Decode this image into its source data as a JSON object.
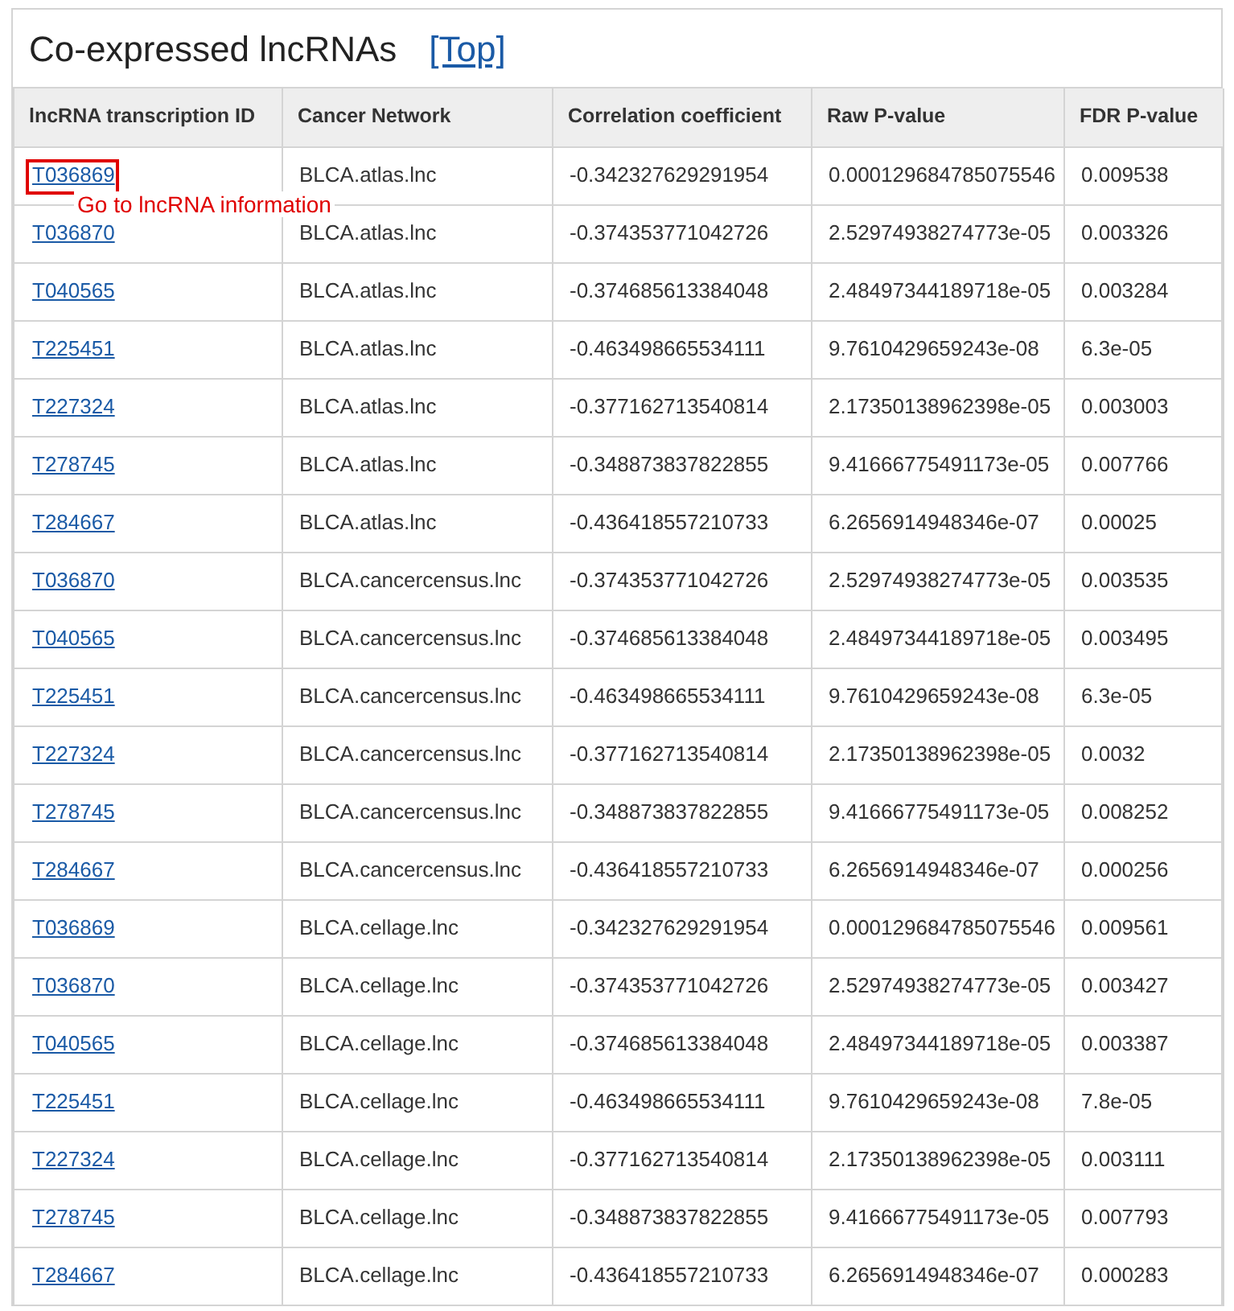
{
  "heading": {
    "title": "Co-expressed lncRNAs",
    "top_link": "[Top]"
  },
  "table": {
    "columns": [
      "lncRNA transcription ID",
      "Cancer Network",
      "Correlation coefficient",
      "Raw P-value",
      "FDR P-value"
    ],
    "rows": [
      {
        "id": "T036869",
        "callout": "Go to lncRNA information",
        "network": "BLCA.atlas.lnc",
        "correlation": "-0.342327629291954",
        "raw_p": "0.000129684785075546",
        "fdr_p": "0.009538"
      },
      {
        "id": "T036870",
        "network": "BLCA.atlas.lnc",
        "correlation": "-0.374353771042726",
        "raw_p": "2.52974938274773e-05",
        "fdr_p": "0.003326"
      },
      {
        "id": "T040565",
        "network": "BLCA.atlas.lnc",
        "correlation": "-0.374685613384048",
        "raw_p": "2.48497344189718e-05",
        "fdr_p": "0.003284"
      },
      {
        "id": "T225451",
        "network": "BLCA.atlas.lnc",
        "correlation": "-0.463498665534111",
        "raw_p": "9.7610429659243e-08",
        "fdr_p": "6.3e-05"
      },
      {
        "id": "T227324",
        "network": "BLCA.atlas.lnc",
        "correlation": "-0.377162713540814",
        "raw_p": "2.17350138962398e-05",
        "fdr_p": "0.003003"
      },
      {
        "id": "T278745",
        "network": "BLCA.atlas.lnc",
        "correlation": "-0.348873837822855",
        "raw_p": "9.41666775491173e-05",
        "fdr_p": "0.007766"
      },
      {
        "id": "T284667",
        "network": "BLCA.atlas.lnc",
        "correlation": "-0.436418557210733",
        "raw_p": "6.2656914948346e-07",
        "fdr_p": "0.00025"
      },
      {
        "id": "T036870",
        "network": "BLCA.cancercensus.lnc",
        "correlation": "-0.374353771042726",
        "raw_p": "2.52974938274773e-05",
        "fdr_p": "0.003535"
      },
      {
        "id": "T040565",
        "network": "BLCA.cancercensus.lnc",
        "correlation": "-0.374685613384048",
        "raw_p": "2.48497344189718e-05",
        "fdr_p": "0.003495"
      },
      {
        "id": "T225451",
        "network": "BLCA.cancercensus.lnc",
        "correlation": "-0.463498665534111",
        "raw_p": "9.7610429659243e-08",
        "fdr_p": "6.3e-05"
      },
      {
        "id": "T227324",
        "network": "BLCA.cancercensus.lnc",
        "correlation": "-0.377162713540814",
        "raw_p": "2.17350138962398e-05",
        "fdr_p": "0.0032"
      },
      {
        "id": "T278745",
        "network": "BLCA.cancercensus.lnc",
        "correlation": "-0.348873837822855",
        "raw_p": "9.41666775491173e-05",
        "fdr_p": "0.008252"
      },
      {
        "id": "T284667",
        "network": "BLCA.cancercensus.lnc",
        "correlation": "-0.436418557210733",
        "raw_p": "6.2656914948346e-07",
        "fdr_p": "0.000256"
      },
      {
        "id": "T036869",
        "network": "BLCA.cellage.lnc",
        "correlation": "-0.342327629291954",
        "raw_p": "0.000129684785075546",
        "fdr_p": "0.009561"
      },
      {
        "id": "T036870",
        "network": "BLCA.cellage.lnc",
        "correlation": "-0.374353771042726",
        "raw_p": "2.52974938274773e-05",
        "fdr_p": "0.003427"
      },
      {
        "id": "T040565",
        "network": "BLCA.cellage.lnc",
        "correlation": "-0.374685613384048",
        "raw_p": "2.48497344189718e-05",
        "fdr_p": "0.003387"
      },
      {
        "id": "T225451",
        "network": "BLCA.cellage.lnc",
        "correlation": "-0.463498665534111",
        "raw_p": "9.7610429659243e-08",
        "fdr_p": "7.8e-05"
      },
      {
        "id": "T227324",
        "network": "BLCA.cellage.lnc",
        "correlation": "-0.377162713540814",
        "raw_p": "2.17350138962398e-05",
        "fdr_p": "0.003111"
      },
      {
        "id": "T278745",
        "network": "BLCA.cellage.lnc",
        "correlation": "-0.348873837822855",
        "raw_p": "9.41666775491173e-05",
        "fdr_p": "0.007793"
      },
      {
        "id": "T284667",
        "network": "BLCA.cellage.lnc",
        "correlation": "-0.436418557210733",
        "raw_p": "6.2656914948346e-07",
        "fdr_p": "0.000283"
      }
    ]
  }
}
